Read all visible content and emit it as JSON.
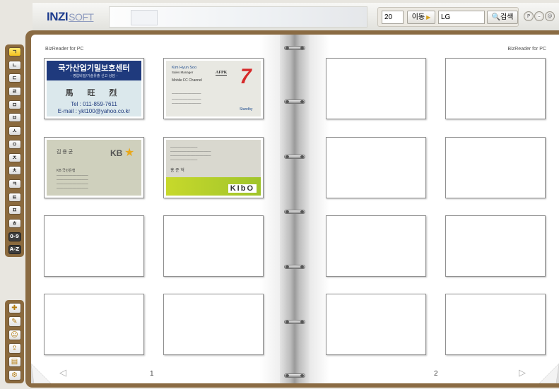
{
  "app": {
    "logo_main": "INZI",
    "logo_sub": "SOFT"
  },
  "toolbar": {
    "page_value": "20",
    "go_label": "이동",
    "search_value": "LG",
    "search_label": "검색",
    "circle_buttons": [
      "P",
      "–",
      "@"
    ]
  },
  "index_tabs": [
    "ㄱ",
    "ㄴ",
    "ㄷ",
    "ㄹ",
    "ㅁ",
    "ㅂ",
    "ㅅ",
    "ㅇ",
    "ㅈ",
    "ㅊ",
    "ㅋ",
    "ㅌ",
    "ㅍ",
    "ㅎ",
    "0-9",
    "A-Z"
  ],
  "tool_icons": [
    "add-card-icon",
    "edit-icon",
    "group-icon",
    "export-icon",
    "print-icon",
    "settings-icon"
  ],
  "left_page": {
    "brand": "BizReader for PC",
    "page_number": "1",
    "cards": {
      "c1": {
        "line1": "국가산업기밀보호센터",
        "line2": "- 영업비밀/기술유출 신고 상담 -",
        "name": "馬 旺 烈",
        "tel": "Tel : 011-859-7611",
        "email": "E-mail : ykt100@yahoo.co.kr"
      },
      "c2": {
        "name": "Kim Hyun Soo",
        "title": "Sales Manager",
        "dept": "Mobile FC Channel",
        "logo": "AFPK",
        "mark": "7",
        "brand2": "Standby"
      },
      "c3": {
        "name": "김 용 균",
        "bank": "KB 국민은행",
        "logo": "KB",
        "star": "★"
      },
      "c4": {
        "name": "홍 준 혁",
        "logo": "KIbO"
      }
    }
  },
  "right_page": {
    "brand": "BizReader for PC",
    "page_number": "2"
  }
}
